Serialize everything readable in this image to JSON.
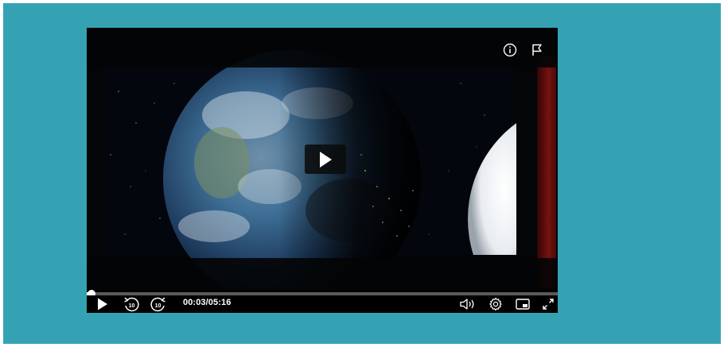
{
  "player": {
    "current_time": "00:03",
    "separator": "/",
    "duration": "05:16",
    "progress_fraction": 0.01,
    "colors": {
      "background": "#35a2b4",
      "player_bg": "#000000",
      "controls_fg": "#ffffff"
    },
    "top_icons": [
      "info-icon",
      "flag-icon"
    ],
    "center_icon": "play-icon",
    "controls": {
      "left": [
        "play-icon",
        "rewind-10-icon",
        "forward-10-icon"
      ],
      "right": [
        "volume-icon",
        "settings-icon",
        "picture-in-picture-icon",
        "fullscreen-icon"
      ],
      "skip_seconds": "10"
    }
  }
}
